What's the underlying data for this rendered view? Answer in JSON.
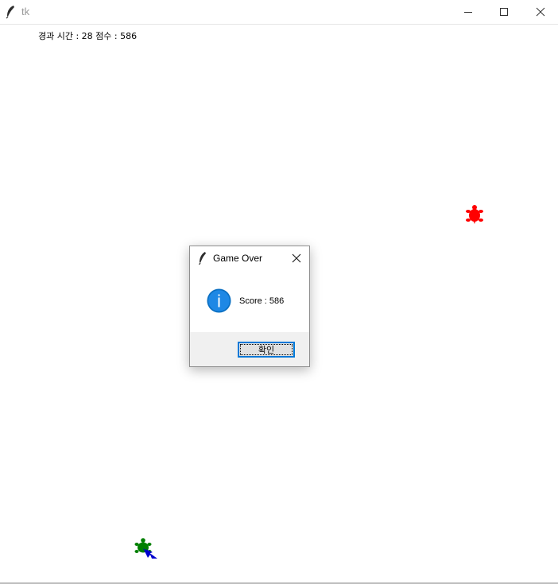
{
  "window": {
    "title": "tk",
    "icon": "feather-icon",
    "controls": [
      "minimize-icon",
      "maximize-icon",
      "close-icon"
    ]
  },
  "hud": {
    "text": "경과 시간 : 28 점수 : 586"
  },
  "sprites": {
    "enemy_turtle": {
      "icon": "turtle-icon",
      "color": "#ff0000"
    },
    "player_turtle": {
      "icon": "turtle-icon",
      "color": "#008000"
    },
    "player_arrow": {
      "icon": "turtle-arrow-icon",
      "color": "#0000cd"
    }
  },
  "dialog": {
    "title": "Game Over",
    "icon": "info-icon",
    "message": "Score : 586",
    "ok_label": "확인",
    "accent": "#0078d7"
  }
}
